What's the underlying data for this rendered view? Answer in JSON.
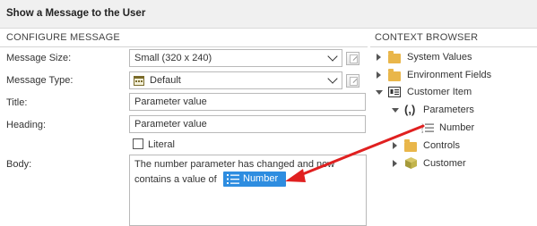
{
  "title": "Show a Message to the User",
  "configure": {
    "heading": "CONFIGURE MESSAGE",
    "message_size": {
      "label": "Message Size:",
      "value": "Small (320 x 240)"
    },
    "message_type": {
      "label": "Message Type:",
      "value": "Default"
    },
    "title_field": {
      "label": "Title:",
      "value": "Parameter value"
    },
    "heading_field": {
      "label": "Heading:",
      "value": "Parameter value"
    },
    "literal_label": "Literal",
    "body": {
      "label": "Body:",
      "line1": "The number parameter has changed and now",
      "line2": "contains a value of",
      "chip": "Number"
    }
  },
  "context": {
    "heading": "CONTEXT BROWSER",
    "items": [
      {
        "label": "System Values"
      },
      {
        "label": "Environment Fields"
      },
      {
        "label": "Customer Item"
      },
      {
        "label": "Parameters",
        "glyph": "(,)"
      },
      {
        "label": "Number"
      },
      {
        "label": "Controls"
      },
      {
        "label": "Customer"
      }
    ]
  },
  "colors": {
    "accent": "#2e8de0",
    "arrow": "#e02020",
    "folder": "#e9b64a"
  }
}
